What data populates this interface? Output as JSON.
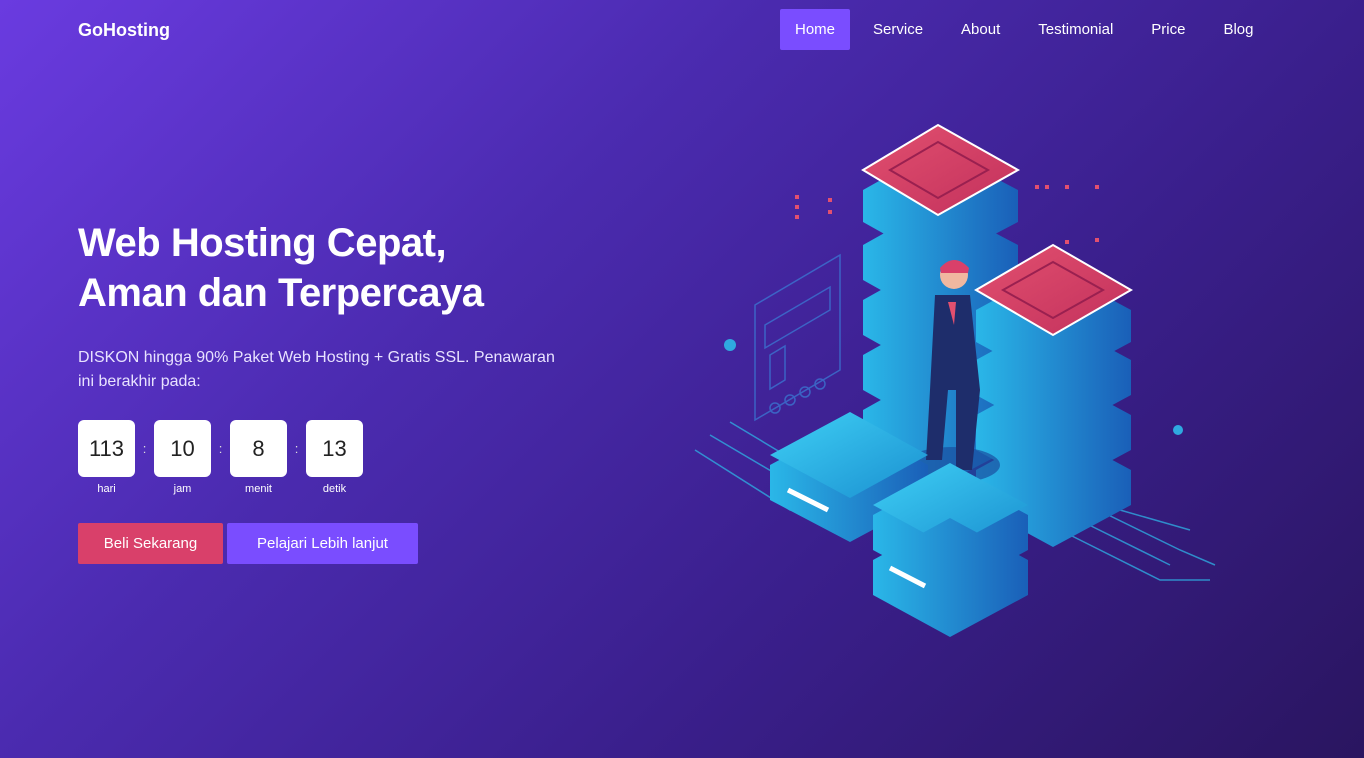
{
  "brand": "GoHosting",
  "nav": {
    "items": [
      "Home",
      "Service",
      "About",
      "Testimonial",
      "Price",
      "Blog"
    ],
    "active": "Home"
  },
  "hero": {
    "title_line1": "Web Hosting Cepat,",
    "title_line2": "Aman dan Terpercaya",
    "description": "DISKON hingga 90% Paket Web Hosting + Gratis SSL. Penawaran ini berakhir pada:"
  },
  "countdown": {
    "separator": ":",
    "units": [
      {
        "value": "113",
        "label": "hari"
      },
      {
        "value": "10",
        "label": "jam"
      },
      {
        "value": "8",
        "label": "menit"
      },
      {
        "value": "13",
        "label": "detik"
      }
    ]
  },
  "buttons": {
    "buy": "Beli Sekarang",
    "learn": "Pelajari Lebih lanjut"
  },
  "colors": {
    "accent": "#7a4dff",
    "buy_button": "#d9406a",
    "server_top": "#d9406a",
    "server_body": "#1fa0d6"
  },
  "illustration": {
    "icon": "server-stack-businessman-illustration"
  }
}
